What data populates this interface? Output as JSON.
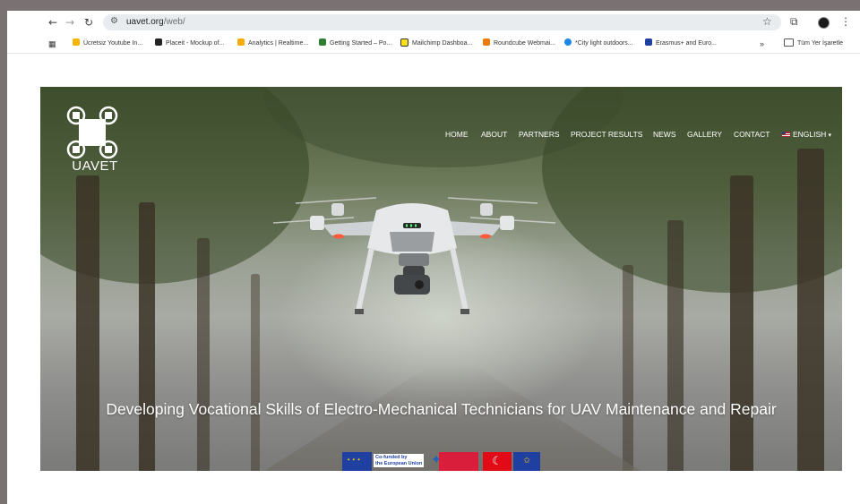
{
  "browser": {
    "url_host": "uavet.org",
    "url_path": "/web/",
    "bookmarks": [
      {
        "label": "Ücretsiz Youtube In...",
        "color": "#f4b400"
      },
      {
        "label": "Placeit - Mockup of...",
        "color": "#222222"
      },
      {
        "label": "Analytics | Realtime...",
        "color": "#f9ab00"
      },
      {
        "label": "Getting Started – Po...",
        "color": "#2e7d32"
      },
      {
        "label": "Mailchimp Dashboa...",
        "color": "#ffe01b"
      },
      {
        "label": "Roundcube Webmai...",
        "color": "#ee7a00"
      },
      {
        "label": "*City light outdoors...",
        "color": "#1e88e5"
      },
      {
        "label": "Erasmus+ and Euro...",
        "color": "#1f3fa1"
      }
    ],
    "overflow_label": "»",
    "all_bookmarks_label": "Tüm Yer İşaretle"
  },
  "site": {
    "logo_text": "UAVET",
    "menu": [
      {
        "label": "HOME"
      },
      {
        "label": "ABOUT"
      },
      {
        "label": "PARTNERS"
      },
      {
        "label": "PROJECT RESULTS"
      },
      {
        "label": "NEWS"
      },
      {
        "label": "GALLERY"
      },
      {
        "label": "CONTACT"
      }
    ],
    "language": "ENGLISH",
    "headline": "Developing Vocational Skills of Electro-Mechanical Technicians for UAV Maintenance and Repair",
    "cofund_line1": "Co-funded by",
    "cofund_line2": "the European Union"
  },
  "colors": {
    "eu_blue": "#1f3fa1",
    "turkey_red": "#e30a17"
  }
}
